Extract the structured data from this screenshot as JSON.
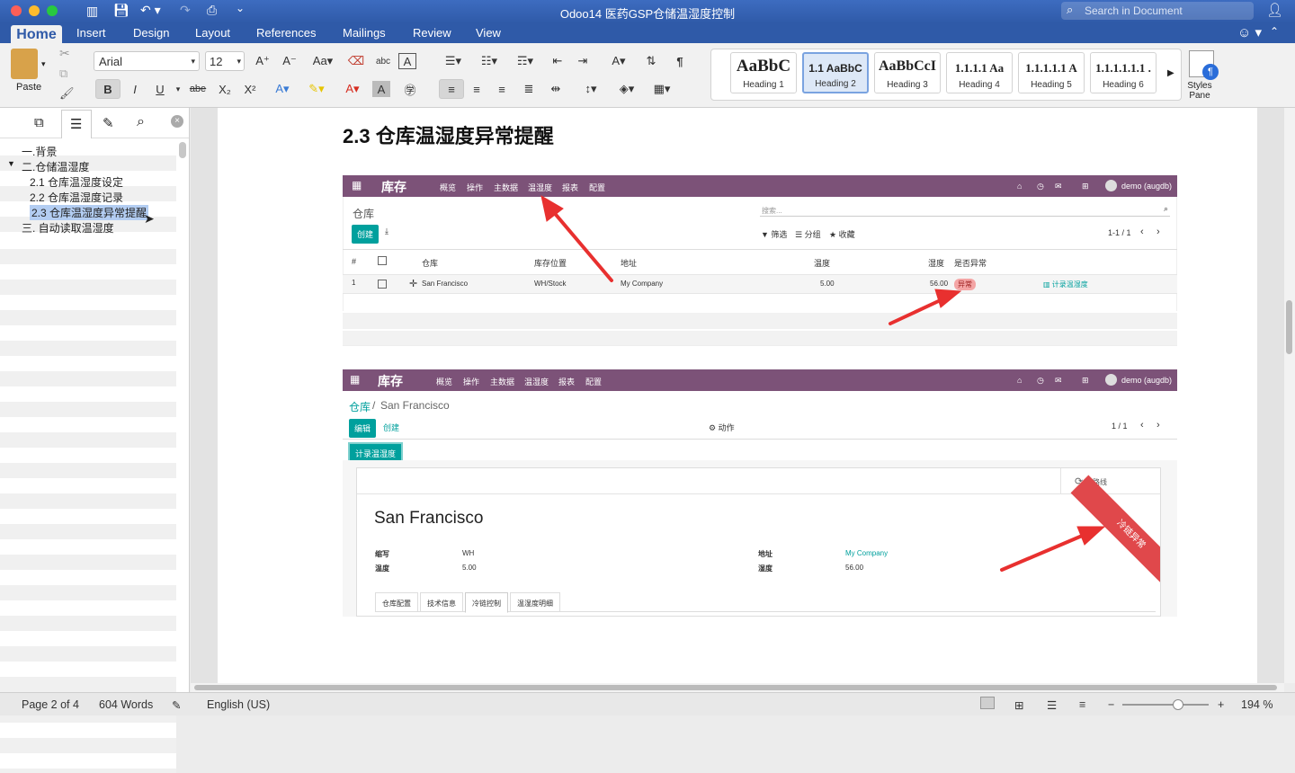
{
  "window": {
    "title": "Odoo14 医药GSP仓储温湿度控制",
    "search_placeholder": "Search in Document"
  },
  "tabs": [
    "Home",
    "Insert",
    "Design",
    "Layout",
    "References",
    "Mailings",
    "Review",
    "View"
  ],
  "ribbon": {
    "paste_label": "Paste",
    "font_name": "Arial",
    "font_size": "12",
    "styles": [
      {
        "sample": "AaBbC",
        "label": "Heading 1"
      },
      {
        "sample": "1.1  AaBbC",
        "label": "Heading 2"
      },
      {
        "sample": "AaBbCcI",
        "label": "Heading 3"
      },
      {
        "sample": "1.1.1.1  Aa",
        "label": "Heading 4"
      },
      {
        "sample": "1.1.1.1.1  A",
        "label": "Heading 5"
      },
      {
        "sample": "1.1.1.1.1.1  .",
        "label": "Heading 6"
      }
    ],
    "styles_pane_label": "Styles Pane"
  },
  "nav": {
    "items": [
      "一.背景",
      "二.仓储温湿度",
      "2.1 仓库温湿度设定",
      "2.2  仓库温湿度记录",
      "2.3  仓库温湿度异常提醒",
      "三.  自动读取温湿度"
    ]
  },
  "doc": {
    "heading": "2.3  仓库温湿度异常提醒"
  },
  "odoo1": {
    "brand": "库存",
    "menu": [
      "概览",
      "操作",
      "主数据",
      "温湿度",
      "报表",
      "配置"
    ],
    "user": "demo (augdb)",
    "breadcrumb": "仓库",
    "search_placeholder": "搜索...",
    "create": "创建",
    "filter": "筛选",
    "group": "分组",
    "fav": "收藏",
    "pager": "1-1 / 1",
    "columns": [
      "#",
      "仓库",
      "库存位置",
      "地址",
      "温度",
      "湿度",
      "是否异常"
    ],
    "row": {
      "num": "1",
      "warehouse": "San Francisco",
      "location": "WH/Stock",
      "address": "My Company",
      "temp": "5.00",
      "humidity": "56.00",
      "badge": "异常",
      "action": "计录温湿度"
    }
  },
  "odoo2": {
    "brand": "库存",
    "menu": [
      "概览",
      "操作",
      "主数据",
      "温湿度",
      "报表",
      "配置"
    ],
    "user": "demo (augdb)",
    "breadcrumb_link": "仓库",
    "breadcrumb_current": "San Francisco",
    "edit": "编辑",
    "create": "创建",
    "action": "动作",
    "pager": "1 / 1",
    "record_btn": "计录温湿度",
    "route_btn": "路线",
    "title": "San Francisco",
    "fields": {
      "code_label": "缩写",
      "code": "WH",
      "temp_label": "温度",
      "temp": "5.00",
      "addr_label": "地址",
      "addr": "My Company",
      "hum_label": "湿度",
      "hum": "56.00"
    },
    "ribbon": "冷链异常",
    "tabs": [
      "仓库配置",
      "技术信息",
      "冷链控制",
      "温湿度明细"
    ]
  },
  "status": {
    "page": "Page 2 of 4",
    "words": "604 Words",
    "lang": "English (US)",
    "zoom": "194 %"
  },
  "colors": {
    "word_blue": "#2f5aa8",
    "odoo_purple": "#7c5278",
    "odoo_teal": "#00a09d",
    "alert_red": "#e0484b"
  }
}
